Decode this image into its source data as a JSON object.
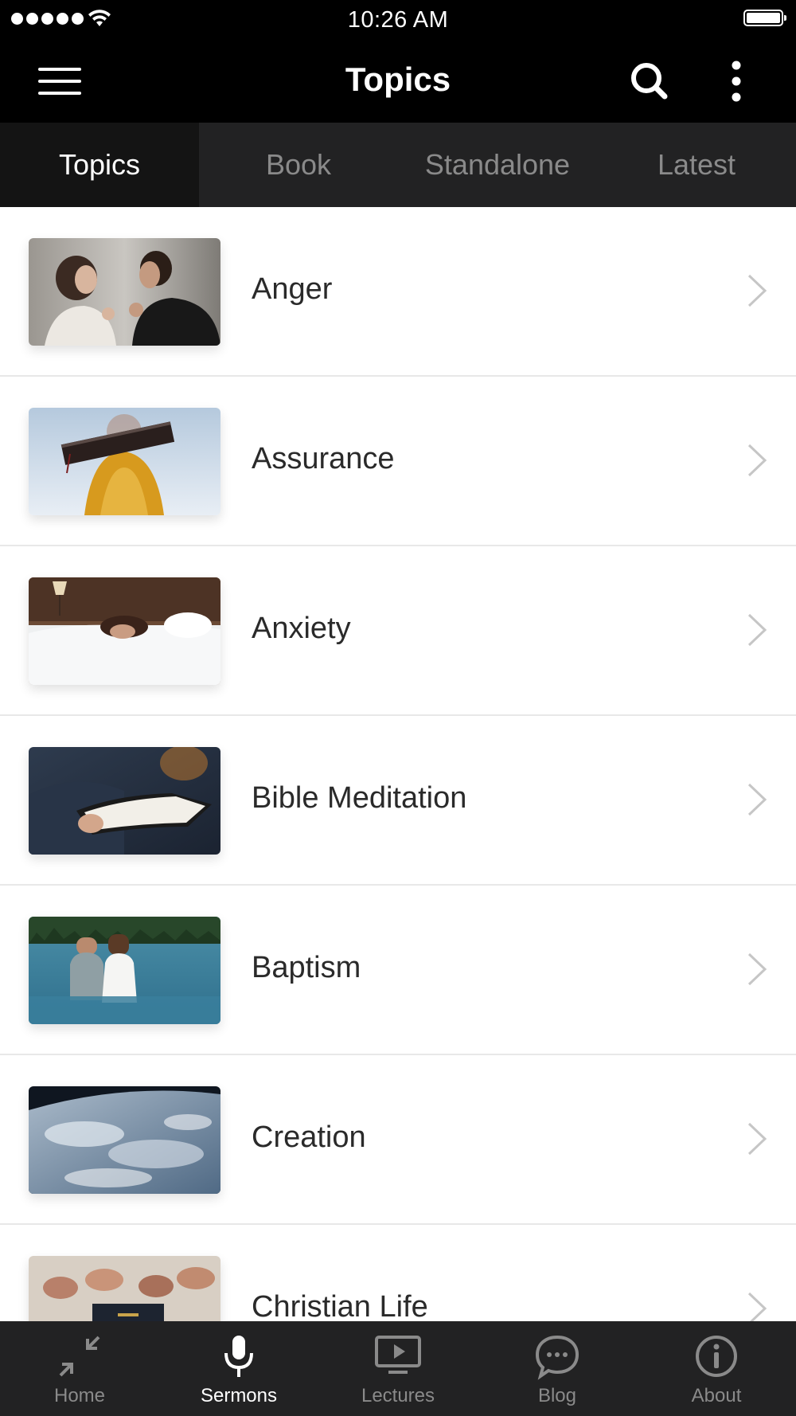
{
  "status_bar": {
    "time": "10:26 AM"
  },
  "header": {
    "title": "Topics",
    "menu_icon": "hamburger-menu-icon",
    "search_icon": "search-icon",
    "more_icon": "more-vertical-icon"
  },
  "tabs": [
    {
      "label": "Topics",
      "active": true
    },
    {
      "label": "Book",
      "active": false
    },
    {
      "label": "Standalone",
      "active": false
    },
    {
      "label": "Latest",
      "active": false
    }
  ],
  "topics": [
    {
      "label": "Anger",
      "thumbnail": "couple-arguing-photo"
    },
    {
      "label": "Assurance",
      "thumbnail": "hand-holding-bible-photo"
    },
    {
      "label": "Anxiety",
      "thumbnail": "woman-in-bed-photo"
    },
    {
      "label": "Bible Meditation",
      "thumbnail": "man-reading-book-photo"
    },
    {
      "label": "Baptism",
      "thumbnail": "lake-baptism-photo"
    },
    {
      "label": "Creation",
      "thumbnail": "earth-from-space-photo"
    },
    {
      "label": "Christian Life",
      "thumbnail": "hands-praying-over-bible-photo"
    }
  ],
  "bottom_nav": [
    {
      "label": "Home",
      "icon": "collapse-arrows-icon",
      "active": false
    },
    {
      "label": "Sermons",
      "icon": "microphone-icon",
      "active": true
    },
    {
      "label": "Lectures",
      "icon": "video-screen-icon",
      "active": false
    },
    {
      "label": "Blog",
      "icon": "chat-bubble-icon",
      "active": false
    },
    {
      "label": "About",
      "icon": "info-icon",
      "active": false
    }
  ],
  "colors": {
    "header_bg": "#000000",
    "tab_bar_bg": "#222223",
    "active_tab_bg": "#141414",
    "inactive_text": "#8a8a8a",
    "active_text": "#ffffff",
    "list_text": "#2a2a2a"
  }
}
